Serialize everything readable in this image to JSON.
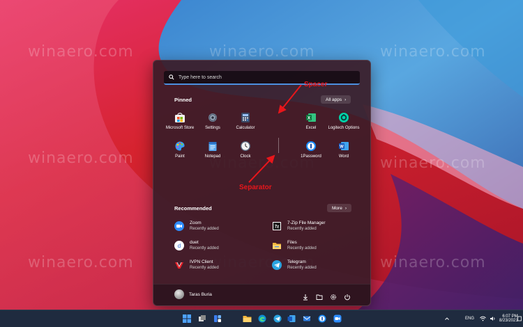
{
  "watermark": "winaero.com",
  "annotations": {
    "spacer": "Spacer",
    "separator": "Separator"
  },
  "search": {
    "placeholder": "Type here to search"
  },
  "pinned": {
    "title": "Pinned",
    "all_apps": "All apps",
    "apps": [
      {
        "label": "Microsoft Store",
        "icon": "microsoft-store-icon"
      },
      {
        "label": "Settings",
        "icon": "settings-gear-icon"
      },
      {
        "label": "Calculator",
        "icon": "calculator-icon"
      },
      {
        "label": "Excel",
        "icon": "excel-icon"
      },
      {
        "label": "Logitech Options",
        "icon": "logitech-options-icon"
      },
      {
        "label": "Paint",
        "icon": "paint-icon"
      },
      {
        "label": "Notepad",
        "icon": "notepad-icon"
      },
      {
        "label": "Clock",
        "icon": "clock-icon"
      },
      {
        "label": "1Password",
        "icon": "onepassword-icon"
      },
      {
        "label": "Word",
        "icon": "word-icon"
      }
    ]
  },
  "recommended": {
    "title": "Recommended",
    "more": "More",
    "items": [
      {
        "name": "Zoom",
        "sub": "Recently added",
        "icon": "zoom-icon"
      },
      {
        "name": "7-Zip File Manager",
        "sub": "Recently added",
        "icon": "7zip-icon"
      },
      {
        "name": "duet",
        "sub": "Recently added",
        "icon": "duet-icon"
      },
      {
        "name": "Files",
        "sub": "Recently added",
        "icon": "files-folder-icon"
      },
      {
        "name": "IVPN Client",
        "sub": "Recently added",
        "icon": "ivpn-icon"
      },
      {
        "name": "Telegram",
        "sub": "Recently added",
        "icon": "telegram-icon"
      }
    ]
  },
  "user": {
    "name": "Taras Buria"
  },
  "tray": {
    "language": "ENG",
    "time": "6:07 PM",
    "date": "8/23/2021"
  },
  "colors": {
    "accent": "#4b8fe0",
    "annotation_red": "#e8161b",
    "start_bg": "#3a1c28",
    "taskbar_bg": "#1f2b3f"
  }
}
